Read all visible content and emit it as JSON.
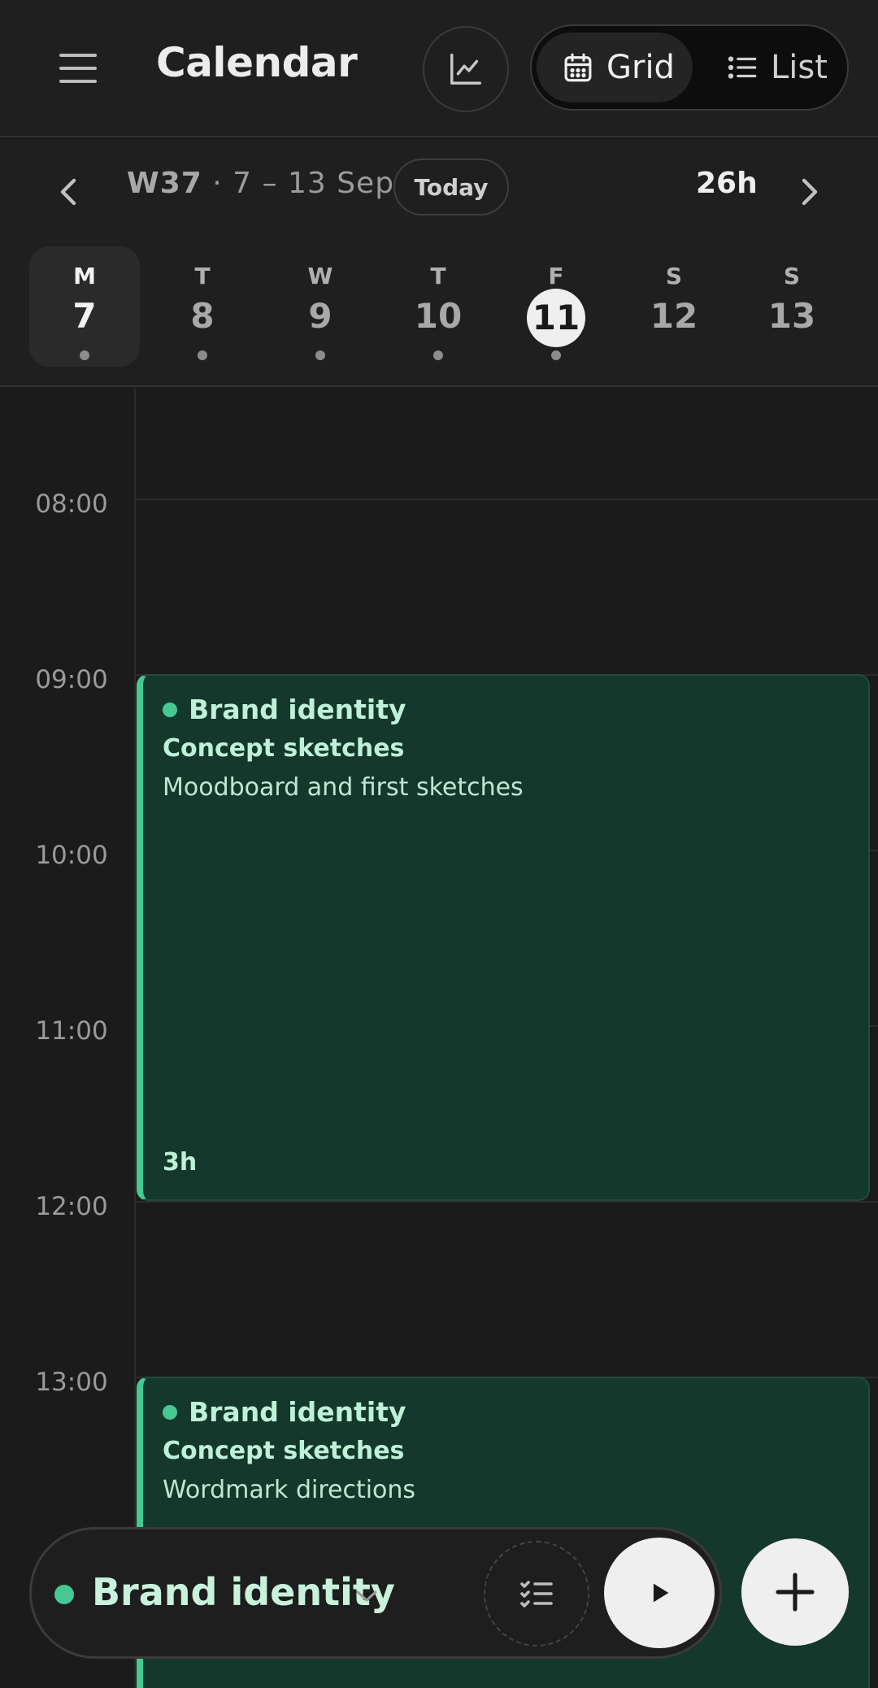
{
  "header": {
    "title": "Calendar",
    "stats_icon": "chart-icon",
    "view_toggle": {
      "grid_label": "Grid",
      "list_label": "List",
      "active": "Grid"
    }
  },
  "week": {
    "week_number": "W37",
    "range": "· 7 – 13 Sep",
    "today_label": "Today",
    "total_hours": "26h",
    "days": [
      {
        "dow": "M",
        "num": "7",
        "selected": true
      },
      {
        "dow": "T",
        "num": "8"
      },
      {
        "dow": "W",
        "num": "9"
      },
      {
        "dow": "T",
        "num": "10"
      },
      {
        "dow": "F",
        "num": "11",
        "today": true
      },
      {
        "dow": "S",
        "num": "12"
      },
      {
        "dow": "S",
        "num": "13"
      }
    ]
  },
  "hours": [
    "08:00",
    "09:00",
    "10:00",
    "11:00",
    "12:00",
    "13:00"
  ],
  "events": [
    {
      "project": "Brand identity",
      "task": "Concept sketches",
      "description": "Moodboard and first sketches",
      "duration": "3h",
      "color": "#45c893"
    },
    {
      "project": "Brand identity",
      "task": "Concept sketches",
      "description": "Wordmark directions",
      "color": "#45c893"
    }
  ],
  "timer": {
    "project": "Brand identity",
    "project_color": "#45c893"
  },
  "colors": {
    "background": "#1b1b1b",
    "accent": "#45c893",
    "event_bg": "#15382c"
  }
}
